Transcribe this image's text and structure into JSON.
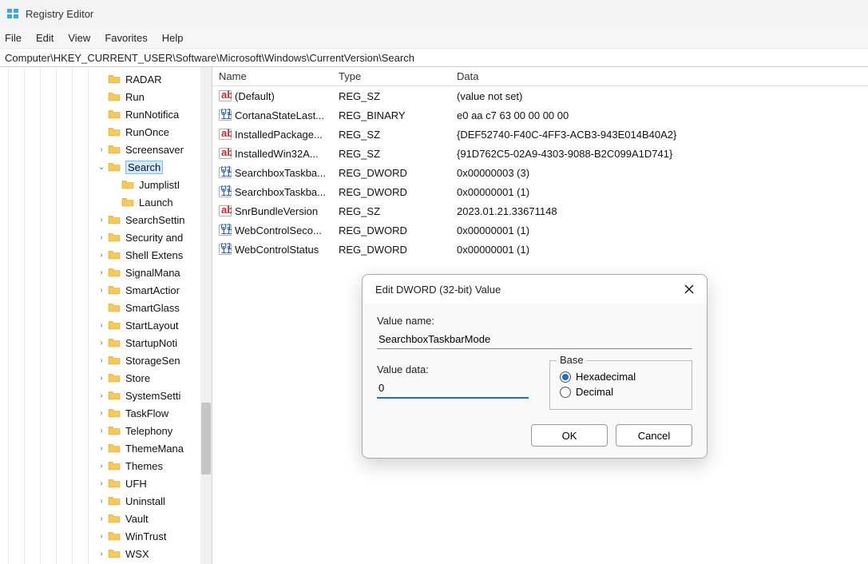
{
  "window": {
    "title": "Registry Editor"
  },
  "menu": {
    "file": "File",
    "edit": "Edit",
    "view": "View",
    "favorites": "Favorites",
    "help": "Help"
  },
  "address": "Computer\\HKEY_CURRENT_USER\\Software\\Microsoft\\Windows\\CurrentVersion\\Search",
  "tree": [
    {
      "label": "RADAR",
      "indent": 7,
      "exp": ""
    },
    {
      "label": "Run",
      "indent": 7,
      "exp": ""
    },
    {
      "label": "RunNotifica",
      "indent": 7,
      "exp": ""
    },
    {
      "label": "RunOnce",
      "indent": 7,
      "exp": ""
    },
    {
      "label": "Screensaver",
      "indent": 7,
      "exp": ">"
    },
    {
      "label": "Search",
      "indent": 7,
      "exp": "v",
      "selected": true
    },
    {
      "label": "JumplistI",
      "indent": 8,
      "exp": ""
    },
    {
      "label": "Launch",
      "indent": 8,
      "exp": ""
    },
    {
      "label": "SearchSettin",
      "indent": 7,
      "exp": ">"
    },
    {
      "label": "Security and",
      "indent": 7,
      "exp": ">"
    },
    {
      "label": "Shell Extens",
      "indent": 7,
      "exp": ">"
    },
    {
      "label": "SignalMana",
      "indent": 7,
      "exp": ">"
    },
    {
      "label": "SmartActior",
      "indent": 7,
      "exp": ">"
    },
    {
      "label": "SmartGlass",
      "indent": 7,
      "exp": ""
    },
    {
      "label": "StartLayout",
      "indent": 7,
      "exp": ">"
    },
    {
      "label": "StartupNoti",
      "indent": 7,
      "exp": ">"
    },
    {
      "label": "StorageSen",
      "indent": 7,
      "exp": ">"
    },
    {
      "label": "Store",
      "indent": 7,
      "exp": ">"
    },
    {
      "label": "SystemSetti",
      "indent": 7,
      "exp": ">"
    },
    {
      "label": "TaskFlow",
      "indent": 7,
      "exp": ">"
    },
    {
      "label": "Telephony",
      "indent": 7,
      "exp": ">"
    },
    {
      "label": "ThemeMana",
      "indent": 7,
      "exp": ">"
    },
    {
      "label": "Themes",
      "indent": 7,
      "exp": ">"
    },
    {
      "label": "UFH",
      "indent": 7,
      "exp": ">"
    },
    {
      "label": "Uninstall",
      "indent": 7,
      "exp": ">"
    },
    {
      "label": "Vault",
      "indent": 7,
      "exp": ">"
    },
    {
      "label": "WinTrust",
      "indent": 7,
      "exp": ">"
    },
    {
      "label": "WSX",
      "indent": 7,
      "exp": ">"
    }
  ],
  "columns": {
    "name": "Name",
    "type": "Type",
    "data": "Data"
  },
  "values": [
    {
      "icon": "sz",
      "name": "(Default)",
      "type": "REG_SZ",
      "data": "(value not set)"
    },
    {
      "icon": "bin",
      "name": "CortanaStateLast...",
      "type": "REG_BINARY",
      "data": "e0 aa c7 63 00 00 00 00"
    },
    {
      "icon": "sz",
      "name": "InstalledPackage...",
      "type": "REG_SZ",
      "data": "{DEF52740-F40C-4FF3-ACB3-943E014B40A2}"
    },
    {
      "icon": "sz",
      "name": "InstalledWin32A...",
      "type": "REG_SZ",
      "data": "{91D762C5-02A9-4303-9088-B2C099A1D741}"
    },
    {
      "icon": "bin",
      "name": "SearchboxTaskba...",
      "type": "REG_DWORD",
      "data": "0x00000003 (3)"
    },
    {
      "icon": "bin",
      "name": "SearchboxTaskba...",
      "type": "REG_DWORD",
      "data": "0x00000001 (1)"
    },
    {
      "icon": "sz",
      "name": "SnrBundleVersion",
      "type": "REG_SZ",
      "data": "2023.01.21.33671148"
    },
    {
      "icon": "bin",
      "name": "WebControlSeco...",
      "type": "REG_DWORD",
      "data": "0x00000001 (1)"
    },
    {
      "icon": "bin",
      "name": "WebControlStatus",
      "type": "REG_DWORD",
      "data": "0x00000001 (1)"
    }
  ],
  "dialog": {
    "title": "Edit DWORD (32-bit) Value",
    "value_name_label": "Value name:",
    "value_name": "SearchboxTaskbarMode",
    "value_data_label": "Value data:",
    "value_data": "0",
    "base_label": "Base",
    "hex_label": "Hexadecimal",
    "dec_label": "Decimal",
    "base_selected": "hex",
    "ok": "OK",
    "cancel": "Cancel"
  }
}
